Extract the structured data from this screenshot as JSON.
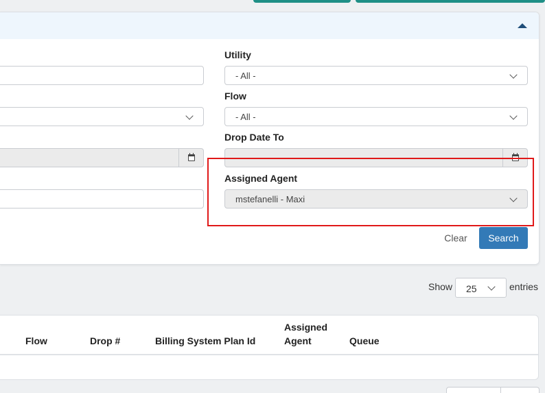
{
  "filters": {
    "utility": {
      "label": "Utility",
      "value": "- All -"
    },
    "flow": {
      "label": "Flow",
      "value": "- All -"
    },
    "drop_date_to": {
      "label": "Drop Date To",
      "value": ""
    },
    "assigned_agent": {
      "label": "Assigned Agent",
      "value": "mstefanelli - Maxi"
    },
    "clear_label": "Clear",
    "search_label": "Search"
  },
  "length_menu": {
    "show_label": "Show",
    "value": "25",
    "entries_label": "entries"
  },
  "table": {
    "columns": [
      "Flow",
      "Drop #",
      "Billing System Plan Id",
      "Assigned Agent",
      "Queue"
    ],
    "rows": []
  },
  "colors": {
    "accent": "#337ab7",
    "teal": "#1f8f86",
    "highlight": "#e01818",
    "header_bg": "#eef6fd"
  },
  "icons": [
    "caret-up-icon",
    "chevron-down-icon",
    "calendar-icon"
  ]
}
